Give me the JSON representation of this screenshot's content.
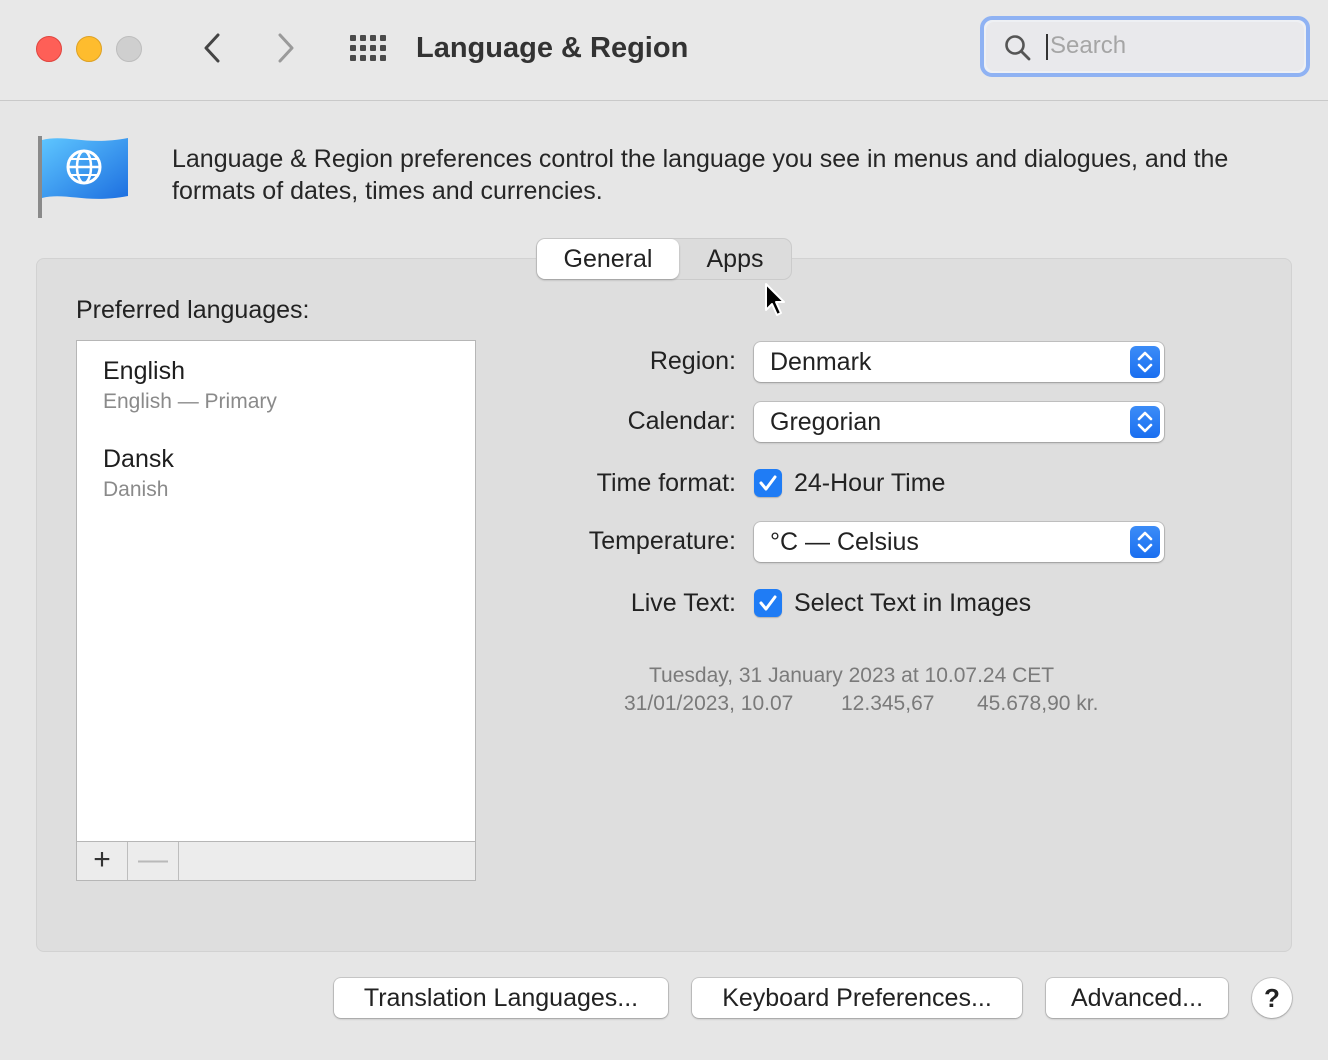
{
  "window": {
    "title": "Language & Region",
    "search_placeholder": "Search"
  },
  "description": "Language & Region preferences control the language you see in menus and dialogues, and the formats of dates, times and currencies.",
  "tabs": [
    {
      "label": "General",
      "selected": true
    },
    {
      "label": "Apps",
      "selected": false
    }
  ],
  "languages": {
    "heading": "Preferred languages:",
    "items": [
      {
        "name": "English",
        "subtitle": "English — Primary"
      },
      {
        "name": "Dansk",
        "subtitle": "Danish"
      }
    ],
    "add_symbol": "+",
    "remove_symbol": "—"
  },
  "settings": {
    "region": {
      "label": "Region:",
      "value": "Denmark"
    },
    "calendar": {
      "label": "Calendar:",
      "value": "Gregorian"
    },
    "time_format": {
      "label": "Time format:",
      "option": "24-Hour Time",
      "checked": true
    },
    "temperature": {
      "label": "Temperature:",
      "value": "°C — Celsius"
    },
    "live_text": {
      "label": "Live Text:",
      "option": "Select Text in Images",
      "checked": true
    }
  },
  "sample": {
    "long_date": "Tuesday, 31 January 2023 at 10.07.24 CET",
    "short_date": "31/01/2023, 10.07",
    "number": "12.345,67",
    "currency": "45.678,90 kr."
  },
  "buttons": {
    "translation": "Translation Languages...",
    "keyboard": "Keyboard Preferences...",
    "advanced": "Advanced...",
    "help": "?"
  },
  "colors": {
    "accent": "#1f7cf5",
    "close": "#fe5f57",
    "minimize": "#febc2e"
  }
}
